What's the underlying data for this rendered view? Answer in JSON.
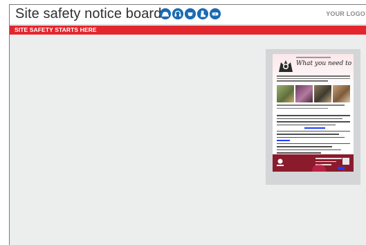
{
  "header": {
    "title": "Site safety notice board",
    "logo_text": "YOUR LOGO",
    "ppe_icons": [
      "hard-hat-icon",
      "ear-protection-icon",
      "safety-mask-icon",
      "safety-boots-icon",
      "safety-goggles-icon"
    ]
  },
  "banner": {
    "text": "SITE SAFETY STARTS HERE",
    "color": "#e3262e"
  },
  "poster": {
    "heading": "What you need to know"
  },
  "colors": {
    "icon_blue": "#1a6bb3",
    "board_background": "#eceeed",
    "poster_footer": "#8b1b2c"
  }
}
